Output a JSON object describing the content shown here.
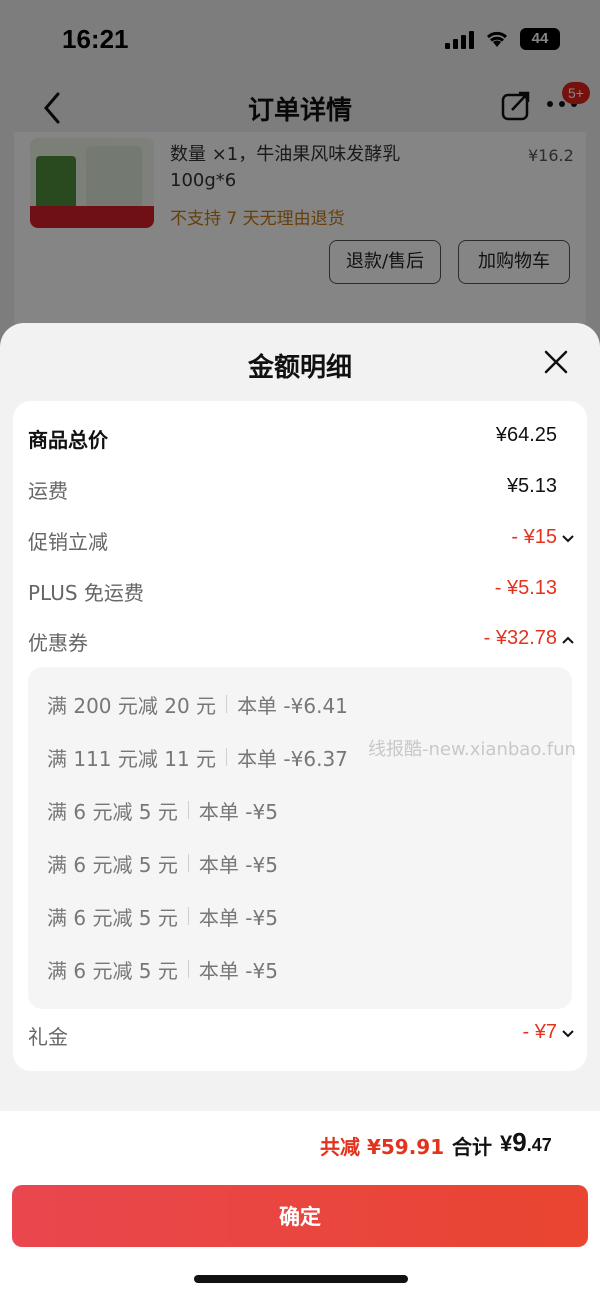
{
  "status_bar": {
    "time": "16:21",
    "battery": "44"
  },
  "nav": {
    "title": "订单详情",
    "badge": "5+"
  },
  "product": {
    "description": "数量 ×1，牛油果风味发酵乳 100g*6",
    "price": "¥16.2",
    "return_policy": "不支持 7 天无理由退货",
    "refund_label": "退款/售后",
    "cart_label": "加购物车"
  },
  "sheet": {
    "title": "金额明细",
    "rows": {
      "total": {
        "label": "商品总价",
        "value": "¥64.25"
      },
      "shipping": {
        "label": "运费",
        "value": "¥5.13"
      },
      "promo": {
        "label": "促销立减",
        "value": "- ¥15"
      },
      "plus": {
        "label": "PLUS 免运费",
        "value": "- ¥5.13"
      },
      "coupon": {
        "label": "优惠券",
        "value": "- ¥32.78"
      },
      "gift": {
        "label": "礼金",
        "value": "- ¥7"
      }
    },
    "coupons": [
      {
        "condition": "满 200 元减 20 元",
        "amount": "本单 -¥6.41"
      },
      {
        "condition": "满 111 元减 11 元",
        "amount": "本单 -¥6.37"
      },
      {
        "condition": "满 6 元减 5 元",
        "amount": "本单 -¥5"
      },
      {
        "condition": "满 6 元减 5 元",
        "amount": "本单 -¥5"
      },
      {
        "condition": "满 6 元减 5 元",
        "amount": "本单 -¥5"
      },
      {
        "condition": "满 6 元减 5 元",
        "amount": "本单 -¥5"
      }
    ],
    "watermark": "线报酷-new.xianbao.fun"
  },
  "summary": {
    "reduced": "共减 ¥59.91",
    "total_label": "合计",
    "total_currency": "¥",
    "total_int": "9",
    "total_dec": ".47"
  },
  "confirm_label": "确定",
  "colors": {
    "accent_red": "#e2331f",
    "button_red": "#e9464f"
  }
}
